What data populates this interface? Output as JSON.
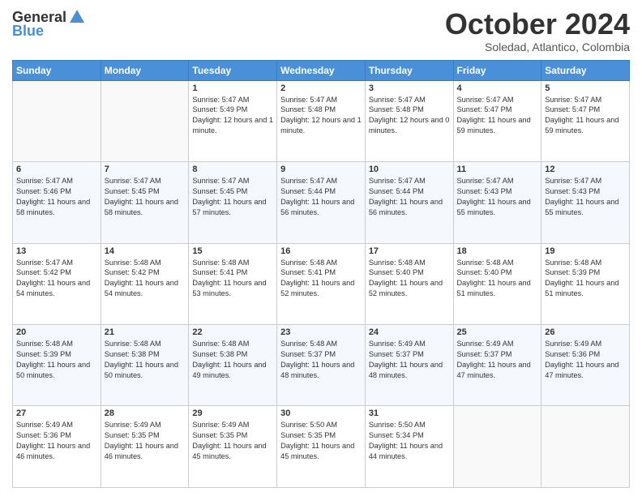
{
  "logo": {
    "general": "General",
    "blue": "Blue"
  },
  "header": {
    "month": "October 2024",
    "location": "Soledad, Atlantico, Colombia"
  },
  "days_of_week": [
    "Sunday",
    "Monday",
    "Tuesday",
    "Wednesday",
    "Thursday",
    "Friday",
    "Saturday"
  ],
  "weeks": [
    [
      {
        "day": "",
        "info": ""
      },
      {
        "day": "",
        "info": ""
      },
      {
        "day": "1",
        "info": "Sunrise: 5:47 AM\nSunset: 5:49 PM\nDaylight: 12 hours and 1 minute."
      },
      {
        "day": "2",
        "info": "Sunrise: 5:47 AM\nSunset: 5:48 PM\nDaylight: 12 hours and 1 minute."
      },
      {
        "day": "3",
        "info": "Sunrise: 5:47 AM\nSunset: 5:48 PM\nDaylight: 12 hours and 0 minutes."
      },
      {
        "day": "4",
        "info": "Sunrise: 5:47 AM\nSunset: 5:47 PM\nDaylight: 11 hours and 59 minutes."
      },
      {
        "day": "5",
        "info": "Sunrise: 5:47 AM\nSunset: 5:47 PM\nDaylight: 11 hours and 59 minutes."
      }
    ],
    [
      {
        "day": "6",
        "info": "Sunrise: 5:47 AM\nSunset: 5:46 PM\nDaylight: 11 hours and 58 minutes."
      },
      {
        "day": "7",
        "info": "Sunrise: 5:47 AM\nSunset: 5:45 PM\nDaylight: 11 hours and 58 minutes."
      },
      {
        "day": "8",
        "info": "Sunrise: 5:47 AM\nSunset: 5:45 PM\nDaylight: 11 hours and 57 minutes."
      },
      {
        "day": "9",
        "info": "Sunrise: 5:47 AM\nSunset: 5:44 PM\nDaylight: 11 hours and 56 minutes."
      },
      {
        "day": "10",
        "info": "Sunrise: 5:47 AM\nSunset: 5:44 PM\nDaylight: 11 hours and 56 minutes."
      },
      {
        "day": "11",
        "info": "Sunrise: 5:47 AM\nSunset: 5:43 PM\nDaylight: 11 hours and 55 minutes."
      },
      {
        "day": "12",
        "info": "Sunrise: 5:47 AM\nSunset: 5:43 PM\nDaylight: 11 hours and 55 minutes."
      }
    ],
    [
      {
        "day": "13",
        "info": "Sunrise: 5:47 AM\nSunset: 5:42 PM\nDaylight: 11 hours and 54 minutes."
      },
      {
        "day": "14",
        "info": "Sunrise: 5:48 AM\nSunset: 5:42 PM\nDaylight: 11 hours and 54 minutes."
      },
      {
        "day": "15",
        "info": "Sunrise: 5:48 AM\nSunset: 5:41 PM\nDaylight: 11 hours and 53 minutes."
      },
      {
        "day": "16",
        "info": "Sunrise: 5:48 AM\nSunset: 5:41 PM\nDaylight: 11 hours and 52 minutes."
      },
      {
        "day": "17",
        "info": "Sunrise: 5:48 AM\nSunset: 5:40 PM\nDaylight: 11 hours and 52 minutes."
      },
      {
        "day": "18",
        "info": "Sunrise: 5:48 AM\nSunset: 5:40 PM\nDaylight: 11 hours and 51 minutes."
      },
      {
        "day": "19",
        "info": "Sunrise: 5:48 AM\nSunset: 5:39 PM\nDaylight: 11 hours and 51 minutes."
      }
    ],
    [
      {
        "day": "20",
        "info": "Sunrise: 5:48 AM\nSunset: 5:39 PM\nDaylight: 11 hours and 50 minutes."
      },
      {
        "day": "21",
        "info": "Sunrise: 5:48 AM\nSunset: 5:38 PM\nDaylight: 11 hours and 50 minutes."
      },
      {
        "day": "22",
        "info": "Sunrise: 5:48 AM\nSunset: 5:38 PM\nDaylight: 11 hours and 49 minutes."
      },
      {
        "day": "23",
        "info": "Sunrise: 5:48 AM\nSunset: 5:37 PM\nDaylight: 11 hours and 48 minutes."
      },
      {
        "day": "24",
        "info": "Sunrise: 5:49 AM\nSunset: 5:37 PM\nDaylight: 11 hours and 48 minutes."
      },
      {
        "day": "25",
        "info": "Sunrise: 5:49 AM\nSunset: 5:37 PM\nDaylight: 11 hours and 47 minutes."
      },
      {
        "day": "26",
        "info": "Sunrise: 5:49 AM\nSunset: 5:36 PM\nDaylight: 11 hours and 47 minutes."
      }
    ],
    [
      {
        "day": "27",
        "info": "Sunrise: 5:49 AM\nSunset: 5:36 PM\nDaylight: 11 hours and 46 minutes."
      },
      {
        "day": "28",
        "info": "Sunrise: 5:49 AM\nSunset: 5:35 PM\nDaylight: 11 hours and 46 minutes."
      },
      {
        "day": "29",
        "info": "Sunrise: 5:49 AM\nSunset: 5:35 PM\nDaylight: 11 hours and 45 minutes."
      },
      {
        "day": "30",
        "info": "Sunrise: 5:50 AM\nSunset: 5:35 PM\nDaylight: 11 hours and 45 minutes."
      },
      {
        "day": "31",
        "info": "Sunrise: 5:50 AM\nSunset: 5:34 PM\nDaylight: 11 hours and 44 minutes."
      },
      {
        "day": "",
        "info": ""
      },
      {
        "day": "",
        "info": ""
      }
    ]
  ]
}
